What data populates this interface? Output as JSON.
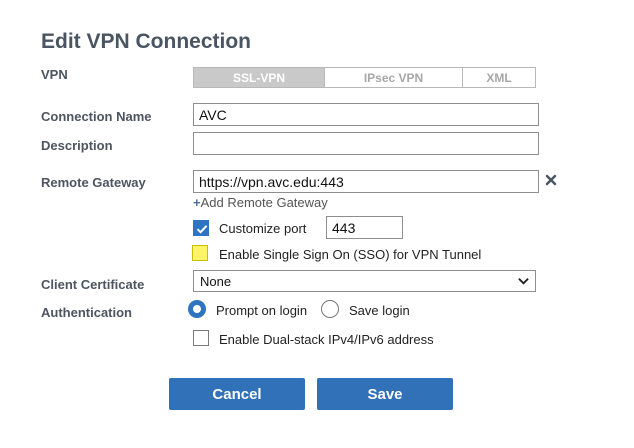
{
  "title": "Edit VPN Connection",
  "labels": {
    "vpn": "VPN",
    "connection_name": "Connection Name",
    "description": "Description",
    "remote_gateway": "Remote Gateway",
    "client_certificate": "Client Certificate",
    "authentication": "Authentication"
  },
  "vpn_types": [
    "SSL-VPN",
    "IPsec VPN",
    "XML"
  ],
  "vpn_type_selected": "SSL-VPN",
  "fields": {
    "connection_name": "AVC",
    "description": "",
    "remote_gateway": "https://vpn.avc.edu:443",
    "port": "443",
    "client_certificate": "None"
  },
  "add_remote_gateway": "Add Remote Gateway",
  "options": {
    "customize_port": {
      "label": "Customize port",
      "checked": true
    },
    "sso": {
      "label": "Enable Single Sign On (SSO) for VPN Tunnel",
      "checked": false,
      "highlight_color": "#fff36a"
    },
    "dual_stack": {
      "label": "Enable Dual-stack IPv4/IPv6 address",
      "checked": false
    }
  },
  "auth": {
    "prompt_label": "Prompt on login",
    "save_label": "Save login",
    "selected": "prompt"
  },
  "buttons": {
    "cancel": "Cancel",
    "save": "Save"
  },
  "icons": {
    "remove_gateway": "close-icon",
    "add_gateway": "plus-icon",
    "dropdown": "chevron-down-icon"
  },
  "colors": {
    "accent": "#3071b7",
    "title": "#4a5563"
  }
}
